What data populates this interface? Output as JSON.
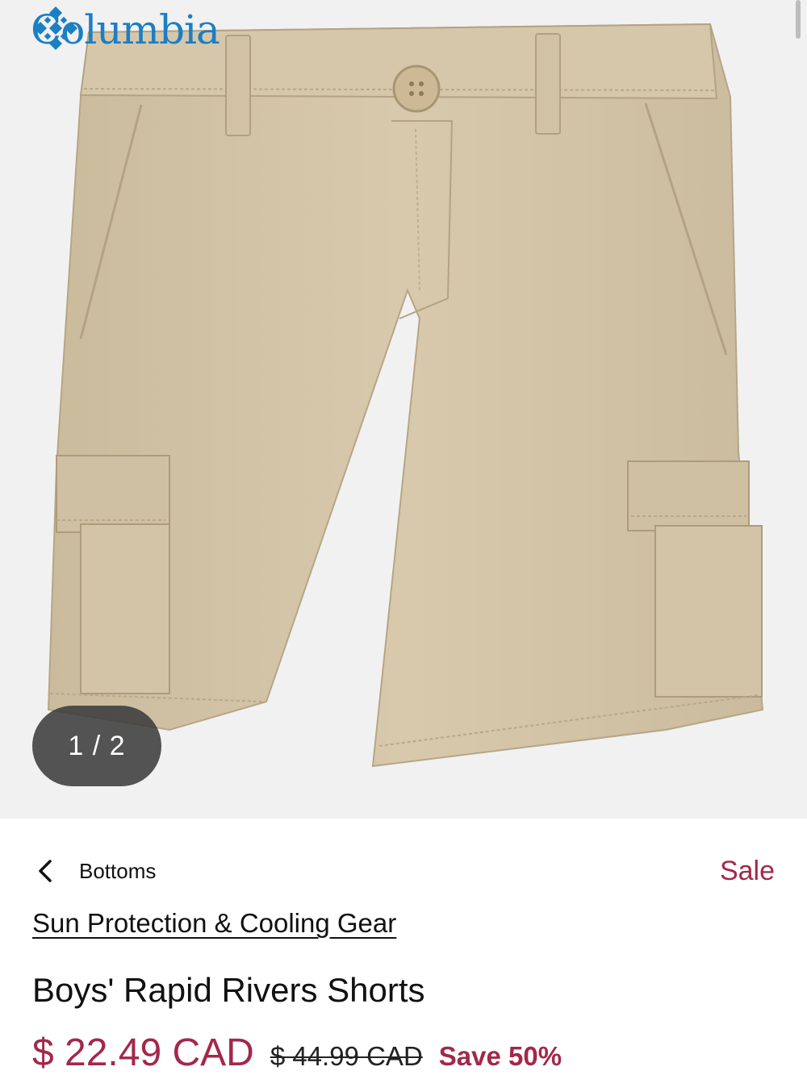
{
  "brand": {
    "name": "Columbia",
    "icon": "columbia-diamond-logo",
    "color": "#1b7fc4"
  },
  "gallery": {
    "counter": "1 / 2",
    "image": "beige-cargo-shorts"
  },
  "breadcrumb": {
    "back_label": "Bottoms",
    "back_icon": "chevron-left-icon"
  },
  "badge": {
    "sale": "Sale",
    "color": "#a3284a"
  },
  "category_link": "Sun Protection & Cooling Gear",
  "product": {
    "title": "Boys' Rapid Rivers Shorts",
    "price_current": "$ 22.49 CAD",
    "price_original": "$ 44.99 CAD",
    "savings": "Save 50%"
  }
}
